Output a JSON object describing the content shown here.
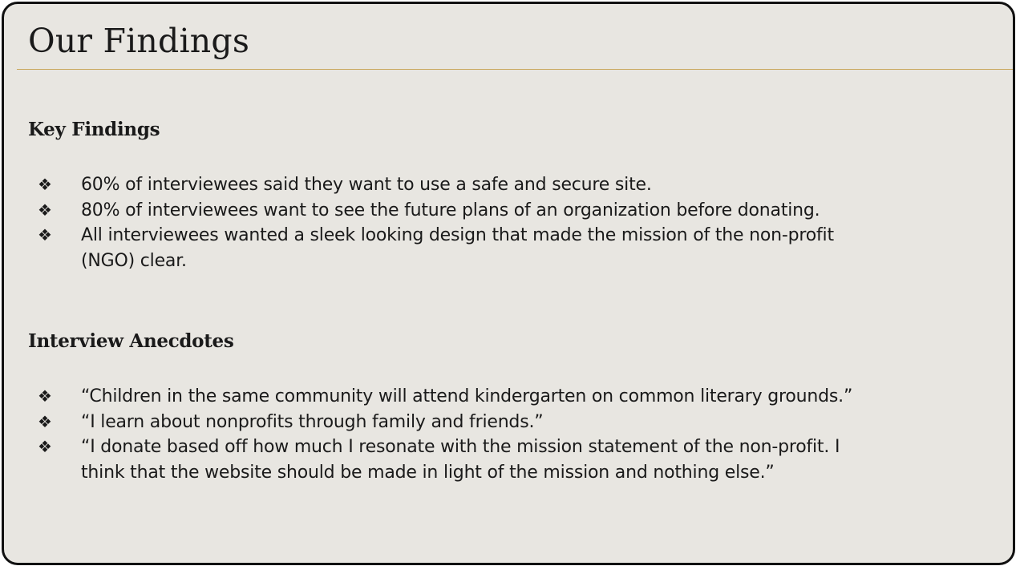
{
  "slide": {
    "title": "Our Findings",
    "sections": [
      {
        "heading": "Key Findings",
        "bullet_icon": "diamond-bullet-icon",
        "items": [
          "60% of interviewees said they want to use a safe and secure site.",
          "80% of interviewees want to see the future plans of an organization before donating.",
          "All interviewees wanted a sleek looking design that made the mission of the non-profit (NGO) clear."
        ]
      },
      {
        "heading": "Interview Anecdotes",
        "bullet_icon": "diamond-bullet-icon",
        "items": [
          "“Children in the same community will attend kindergarten on common literary grounds.”",
          "“I learn about nonprofits through family and friends.”",
          "“I donate based off how much I resonate with the mission statement of the non-profit. I think that the website should be made in light of the mission and nothing else.”"
        ]
      }
    ]
  },
  "colors": {
    "background": "#e8e6e1",
    "border": "#111111",
    "title_rule": "#c9a85e",
    "text": "#1a1a1a"
  }
}
